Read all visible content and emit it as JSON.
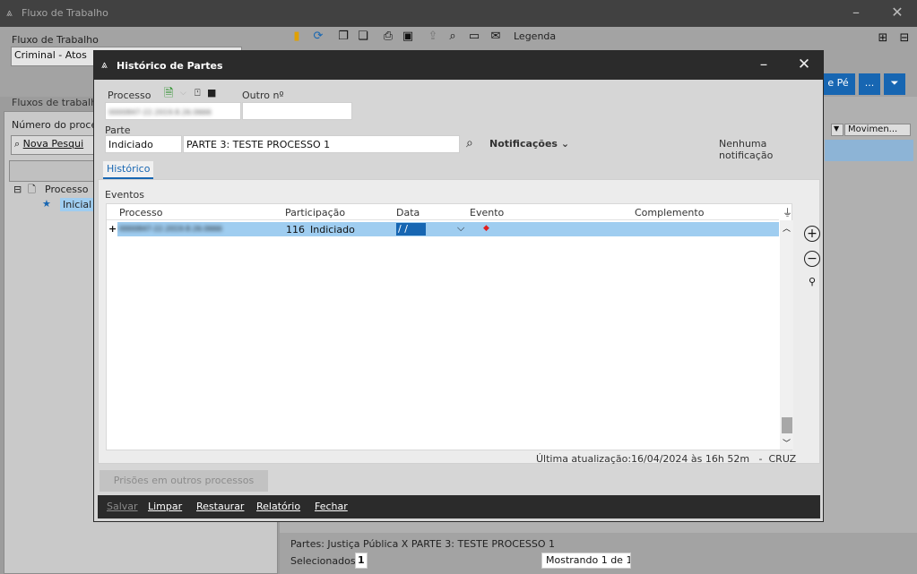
{
  "main": {
    "title": "Fluxo de Trabalho",
    "fluxo_label": "Fluxo de Trabalho",
    "fluxo_value": "Criminal - Atos",
    "legenda": "Legenda",
    "fluxos_label": "Fluxos de trabalho",
    "numero_label": "Número do proce",
    "nova_pesquisa": "Nova Pesqui",
    "tree_processo": "Processo",
    "tree_inicial": "Inicial -",
    "pe_button": "e Pé",
    "more_button": "...",
    "movimen_header": "Movimen...",
    "partes_status": "Partes: Justiça Pública  X  PARTE 3: TESTE PROCESSO 1",
    "selecionados_label": "Selecionados",
    "selecionados_value": "1",
    "mostrando": "Mostrando 1 de 1"
  },
  "dialog": {
    "title": "Histórico de Partes",
    "processo_label": "Processo",
    "processo_value": "0000847-22.2019.8.26.0666",
    "outro_label": "Outro nº",
    "outro_value": "",
    "parte_label": "Parte",
    "parte_tipo": "Indiciado",
    "parte_nome": "PARTE 3: TESTE PROCESSO 1",
    "notificacoes": "Notificações",
    "nenhuma": "Nenhuma notificação",
    "tab": "Histórico",
    "eventos_label": "Eventos",
    "columns": [
      "Processo",
      "Participação",
      "Data",
      "Evento",
      "Complemento"
    ],
    "row": {
      "expand": "+",
      "processo": "0000847-22.2019.8.26.0666",
      "participacao_num": "116",
      "participacao": "Indiciado",
      "data": " / /",
      "evento": "◆",
      "complemento": ""
    },
    "ultima_label": "Última atualização:",
    "ultima_value": "16/04/2024 às 16h 52m   -  CRUZ",
    "prisoes": "Prisões em outros processos",
    "footer": [
      "Salvar",
      "Limpar",
      "Restaurar",
      "Relatório",
      "Fechar"
    ]
  },
  "colors": {
    "accent": "#1766b2",
    "row_selected": "#9fcdf0",
    "titlebar": "#2b2b2b"
  }
}
